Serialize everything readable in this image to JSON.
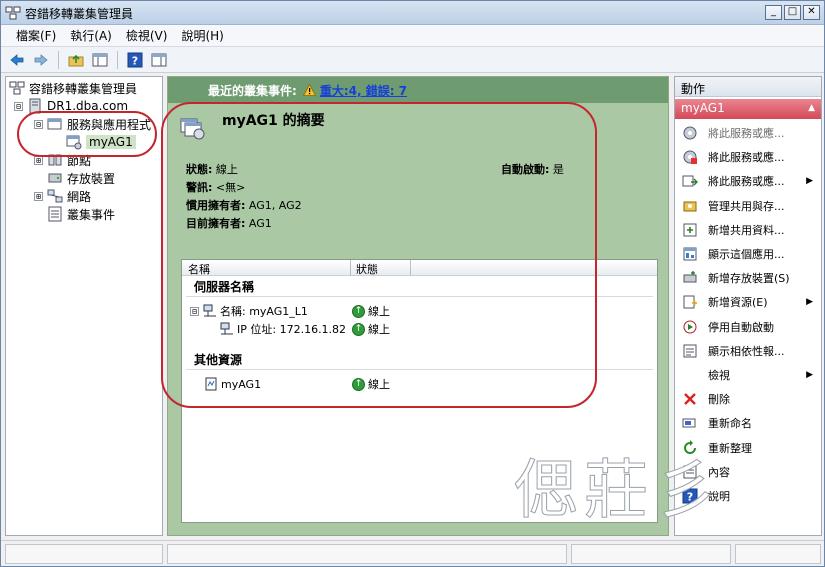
{
  "window": {
    "title": "容錯移轉叢集管理員",
    "controls": {
      "minimize": "_",
      "restore": "□",
      "close": "✕"
    }
  },
  "menu": [
    "檔案(F)",
    "執行(A)",
    "檢視(V)",
    "說明(H)"
  ],
  "toolbar": {
    "icons": [
      "back-arrow-icon",
      "forward-arrow-icon",
      "folder-up-icon",
      "show-hide-pane-icon",
      "help-icon",
      "console-icon"
    ]
  },
  "tree": {
    "root": "容錯移轉叢集管理員",
    "cluster": "DR1.dba.com",
    "services": "服務與應用程式",
    "selected": "myAG1",
    "nodes": "節點",
    "storage": "存放裝置",
    "networks": "網路",
    "events": "叢集事件",
    "toggles": {
      "cluster": "⊟",
      "services": "⊟",
      "nodes": "⊞",
      "networks": "⊞"
    }
  },
  "center": {
    "events_label": "最近的叢集事件:",
    "events_link": "重大:4, 錯誤: 7",
    "summary_title": "myAG1 的摘要",
    "status_label": "狀態:",
    "status_value": "線上",
    "alert_label": "警訊:",
    "alert_value": "<無>",
    "preferred_label": "慣用擁有者:",
    "preferred_value": "AG1, AG2",
    "current_label": "目前擁有者:",
    "current_value": "AG1",
    "autostart_label": "自動啟動:",
    "autostart_value": "是",
    "table": {
      "col_name": "名稱",
      "col_status": "狀態",
      "group1": "伺服器名稱",
      "row1_name": "名稱: myAG1_L1",
      "row1_status": "線上",
      "row1_toggle": "⊟",
      "row2_name": "IP 位址: 172.16.1.82",
      "row2_status": "線上",
      "group2": "其他資源",
      "row3_name": "myAG1",
      "row3_status": "線上"
    }
  },
  "actions": {
    "header": "動作",
    "subheader": "myAG1",
    "items": [
      {
        "label": "將此服務或應...",
        "icon": "bring-online-icon",
        "dim": true
      },
      {
        "label": "將此服務或應...",
        "icon": "take-offline-icon",
        "dim": false
      },
      {
        "label": "將此服務或應...",
        "icon": "move-service-icon",
        "dim": false,
        "submenu": true
      },
      {
        "label": "管理共用與存...",
        "icon": "share-icon",
        "dim": false
      },
      {
        "label": "新增共用資料...",
        "icon": "add-share-icon",
        "dim": false
      },
      {
        "label": "顯示這個應用...",
        "icon": "dashboard-icon",
        "dim": false
      },
      {
        "label": "新增存放裝置(S)",
        "icon": "add-storage-icon",
        "dim": false
      },
      {
        "label": "新增資源(E)",
        "icon": "add-resource-icon",
        "dim": false,
        "submenu": true
      },
      {
        "label": "停用自動啟動",
        "icon": "disable-autostart-icon",
        "dim": false
      },
      {
        "label": "顯示相依性報...",
        "icon": "dependency-report-icon",
        "dim": false
      },
      {
        "label": "檢視",
        "icon": "",
        "dim": false,
        "submenu": true
      },
      {
        "label": "刪除",
        "icon": "delete-icon",
        "dim": false
      },
      {
        "label": "重新命名",
        "icon": "rename-icon",
        "dim": false
      },
      {
        "label": "重新整理",
        "icon": "refresh-icon",
        "dim": false
      },
      {
        "label": "內容",
        "icon": "properties-icon",
        "dim": false
      },
      {
        "label": "說明",
        "icon": "help-icon",
        "dim": false
      }
    ]
  },
  "watermark": "偲莊彡",
  "colors": {
    "center_bg": "#aac8a3",
    "events_bar": "#6f9b70",
    "actions_sub": "#d34a59",
    "annotation": "#c4262e"
  }
}
